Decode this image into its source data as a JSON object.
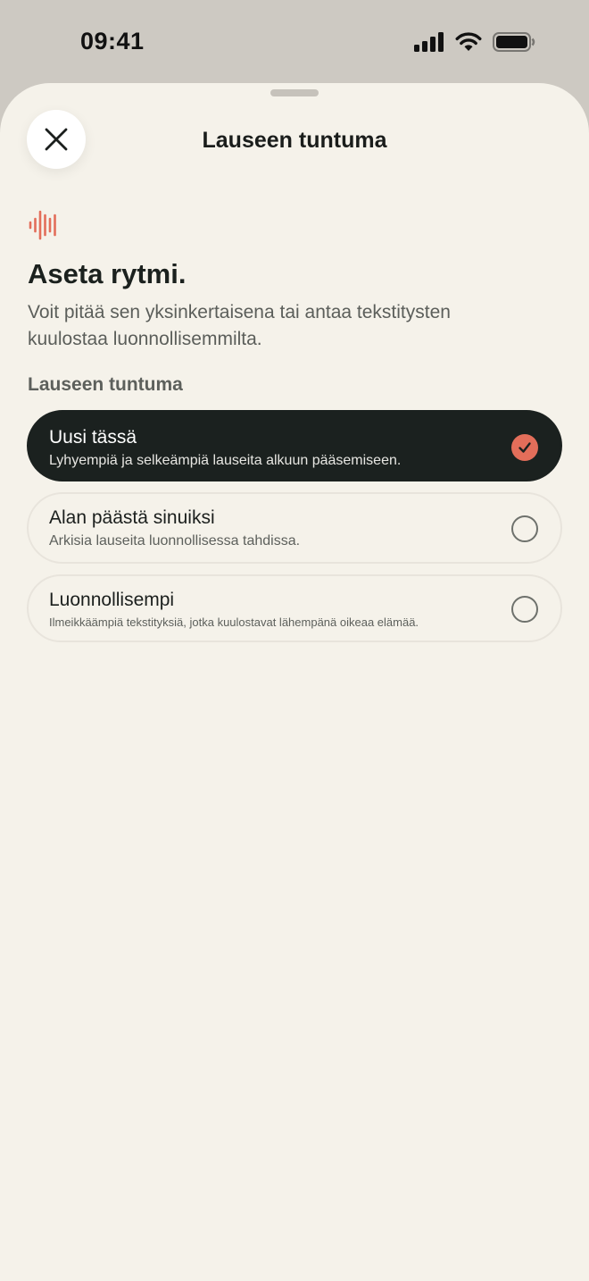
{
  "status_bar": {
    "time": "09:41",
    "icons": [
      "cellular-signal-icon",
      "wifi-icon",
      "battery-icon"
    ]
  },
  "sheet": {
    "title": "Lauseen tuntuma",
    "close_icon": "close-icon"
  },
  "intro": {
    "icon": "sound-wave-icon",
    "heading": "Aseta rytmi.",
    "subtext": "Voit pitää sen yksinkertaisena tai antaa tekstitysten kuulostaa luonnollisemmilta."
  },
  "section_label": "Lauseen tuntuma",
  "options": [
    {
      "title": "Uusi tässä",
      "description": "Lyhyempiä ja selkeämpiä lauseita alkuun pääsemiseen.",
      "selected": true
    },
    {
      "title": "Alan päästä sinuiksi",
      "description": "Arkisia lauseita luonnollisessa tahdissa.",
      "selected": false
    },
    {
      "title": "Luonnollisempi",
      "description": "Ilmeikkäämpiä tekstityksiä, jotka kuulostavat lähempänä oikeaa elämää.",
      "selected": false
    }
  ],
  "colors": {
    "accent": "#e36e5a",
    "selected_background": "#1b211f",
    "sheet_background": "#f5f2ea",
    "backdrop": "#cdc9c2"
  }
}
